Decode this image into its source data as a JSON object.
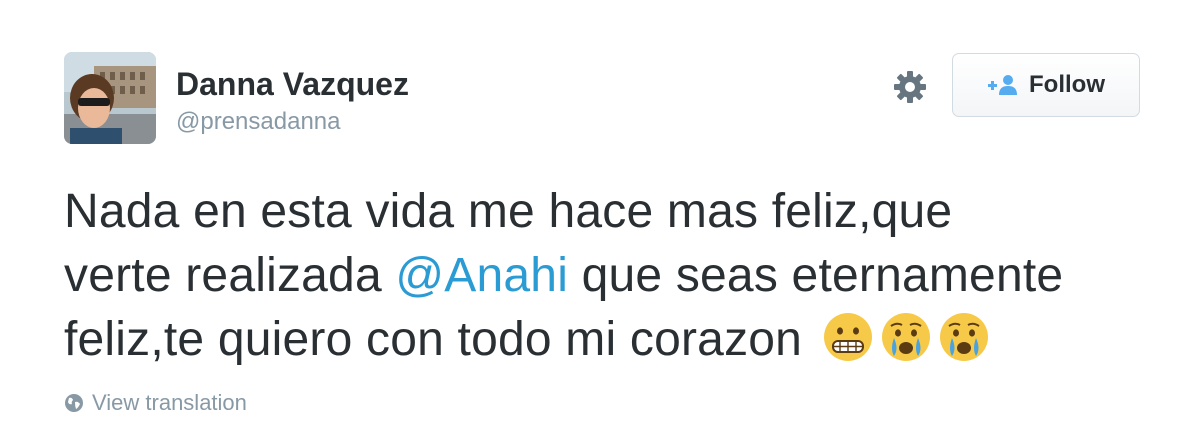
{
  "user": {
    "name": "Danna Vazquez",
    "handle": "@prensadanna",
    "avatar_icon": "profile-photo"
  },
  "actions": {
    "settings_icon": "gear-icon",
    "follow_label": "Follow",
    "follow_icon": "add-person-icon"
  },
  "tweet": {
    "line1": "Nada en esta vida me hace mas feliz,que",
    "line2_before": "verte realizada ",
    "mention": "@Anahi",
    "line2_after": " que seas eternamente",
    "line3": "feliz,te quiero con todo mi corazon",
    "emojis": [
      "grimacing-face",
      "crying-face",
      "crying-face"
    ]
  },
  "translation": {
    "label": "View translation",
    "icon": "globe-icon"
  },
  "colors": {
    "text": "#292f33",
    "muted": "#8899a6",
    "link": "#2b9bd4",
    "follow_blue": "#55acee",
    "emoji_yellow": "#f7c948",
    "tear_blue": "#4aa3e0"
  }
}
